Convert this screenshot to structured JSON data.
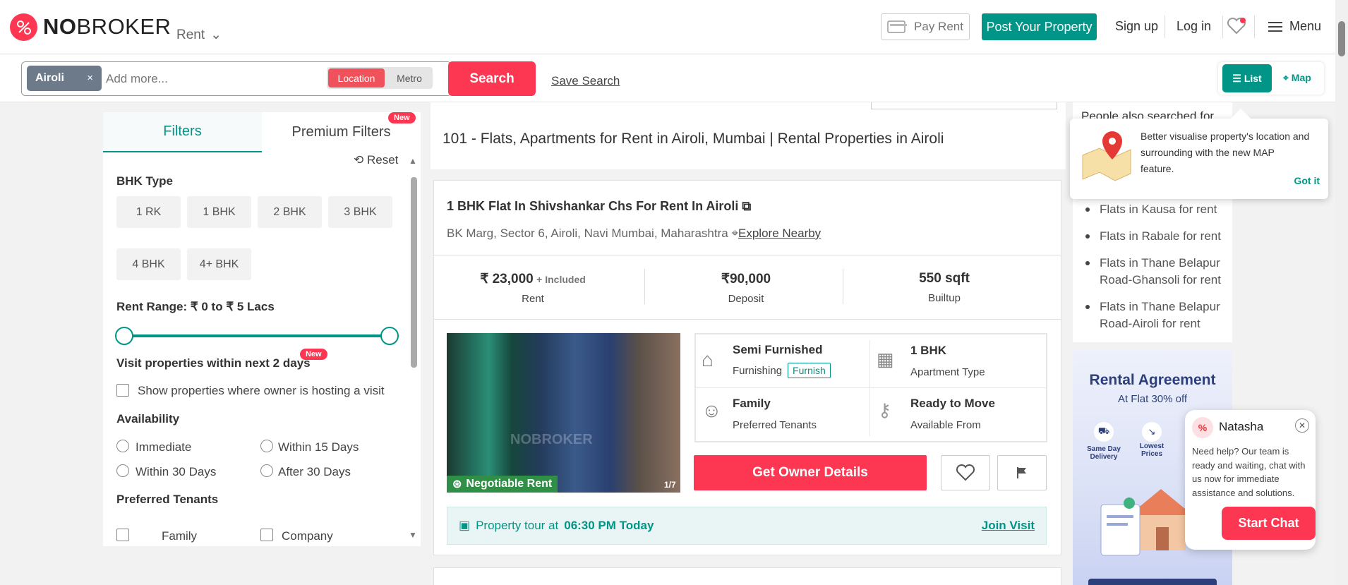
{
  "brand": {
    "name_bold": "NO",
    "name_rest": "BROKER",
    "color": "#fd3752"
  },
  "nav": {
    "rent_dropdown": "Rent",
    "pay_rent": "Pay Rent",
    "post_property": "Post Your Property",
    "signup": "Sign up",
    "login": "Log in",
    "menu": "Menu"
  },
  "search": {
    "chip": "Airoli",
    "chip_close": "×",
    "placeholder": "Add more...",
    "location": "Location",
    "metro": "Metro",
    "button": "Search",
    "save": "Save Search"
  },
  "view": {
    "list": "List",
    "map": "Map"
  },
  "filters": {
    "tab_filters": "Filters",
    "tab_premium": "Premium Filters",
    "new_badge": "New",
    "reset": "Reset",
    "bhk_title": "BHK Type",
    "bhk_options": [
      "1 RK",
      "1 BHK",
      "2 BHK",
      "3 BHK",
      "4 BHK",
      "4+ BHK"
    ],
    "rent_range": "Rent Range: ₹ 0 to ₹ 5 Lacs",
    "visit_title": "Visit properties within next 2 days",
    "visit_new": "New",
    "visit_checkbox": "Show properties where owner is hosting a visit",
    "availability_title": "Availability",
    "availability": [
      "Immediate",
      "Within 15 Days",
      "Within 30 Days",
      "After 30 Days"
    ],
    "tenants_title": "Preferred Tenants",
    "tenants": [
      "Family",
      "Company"
    ]
  },
  "main": {
    "heading": "101 - Flats, Apartments for Rent in Airoli, Mumbai | Rental Properties in Airoli",
    "card": {
      "title": "1 BHK Flat In Shivshankar Chs For Rent In Airoli",
      "address": "BK Marg, Sector 6, Airoli, Navi Mumbai, Maharashtra",
      "explore": "Explore Nearby",
      "rent_value": "₹ 23,000",
      "rent_extra": "+ Included",
      "rent_label": "Rent",
      "deposit_value": "₹90,000",
      "deposit_label": "Deposit",
      "builtup_value": "550 sqft",
      "builtup_label": "Builtup",
      "negotiable": "Negotiable Rent",
      "photo_count": "1/7",
      "watermark": "NOBROKER",
      "furnishing_value": "Semi Furnished",
      "furnishing_label": "Furnishing",
      "furnish_badge": "Furnish",
      "apt_value": "1 BHK",
      "apt_label": "Apartment Type",
      "tenants_value": "Family",
      "tenants_label": "Preferred Tenants",
      "ready_value": "Ready to Move",
      "ready_label": "Available From",
      "owner_button": "Get Owner Details",
      "tour_text": "Property tour at",
      "tour_time": "06:30 PM Today",
      "join": "Join Visit"
    }
  },
  "right": {
    "people": "People also searched for",
    "links": [
      "Flats in Kausa for rent",
      "Flats in Rabale for rent",
      "Flats in Thane Belapur Road-Ghansoli for rent",
      "Flats in Thane Belapur Road-Airoli for rent"
    ],
    "tooltip": "Better visualise property's location and surrounding with the new MAP feature.",
    "gotit": "Got it",
    "ad_title": "Rental Agreement",
    "ad_sub": "At Flat 30% off",
    "ad_features": [
      "Same Day Delivery",
      "Lowest Prices"
    ]
  },
  "chat": {
    "name": "Natasha",
    "message": "Need help? Our team is ready and waiting, chat with us now for immediate assistance and solutions.",
    "button": "Start Chat"
  }
}
